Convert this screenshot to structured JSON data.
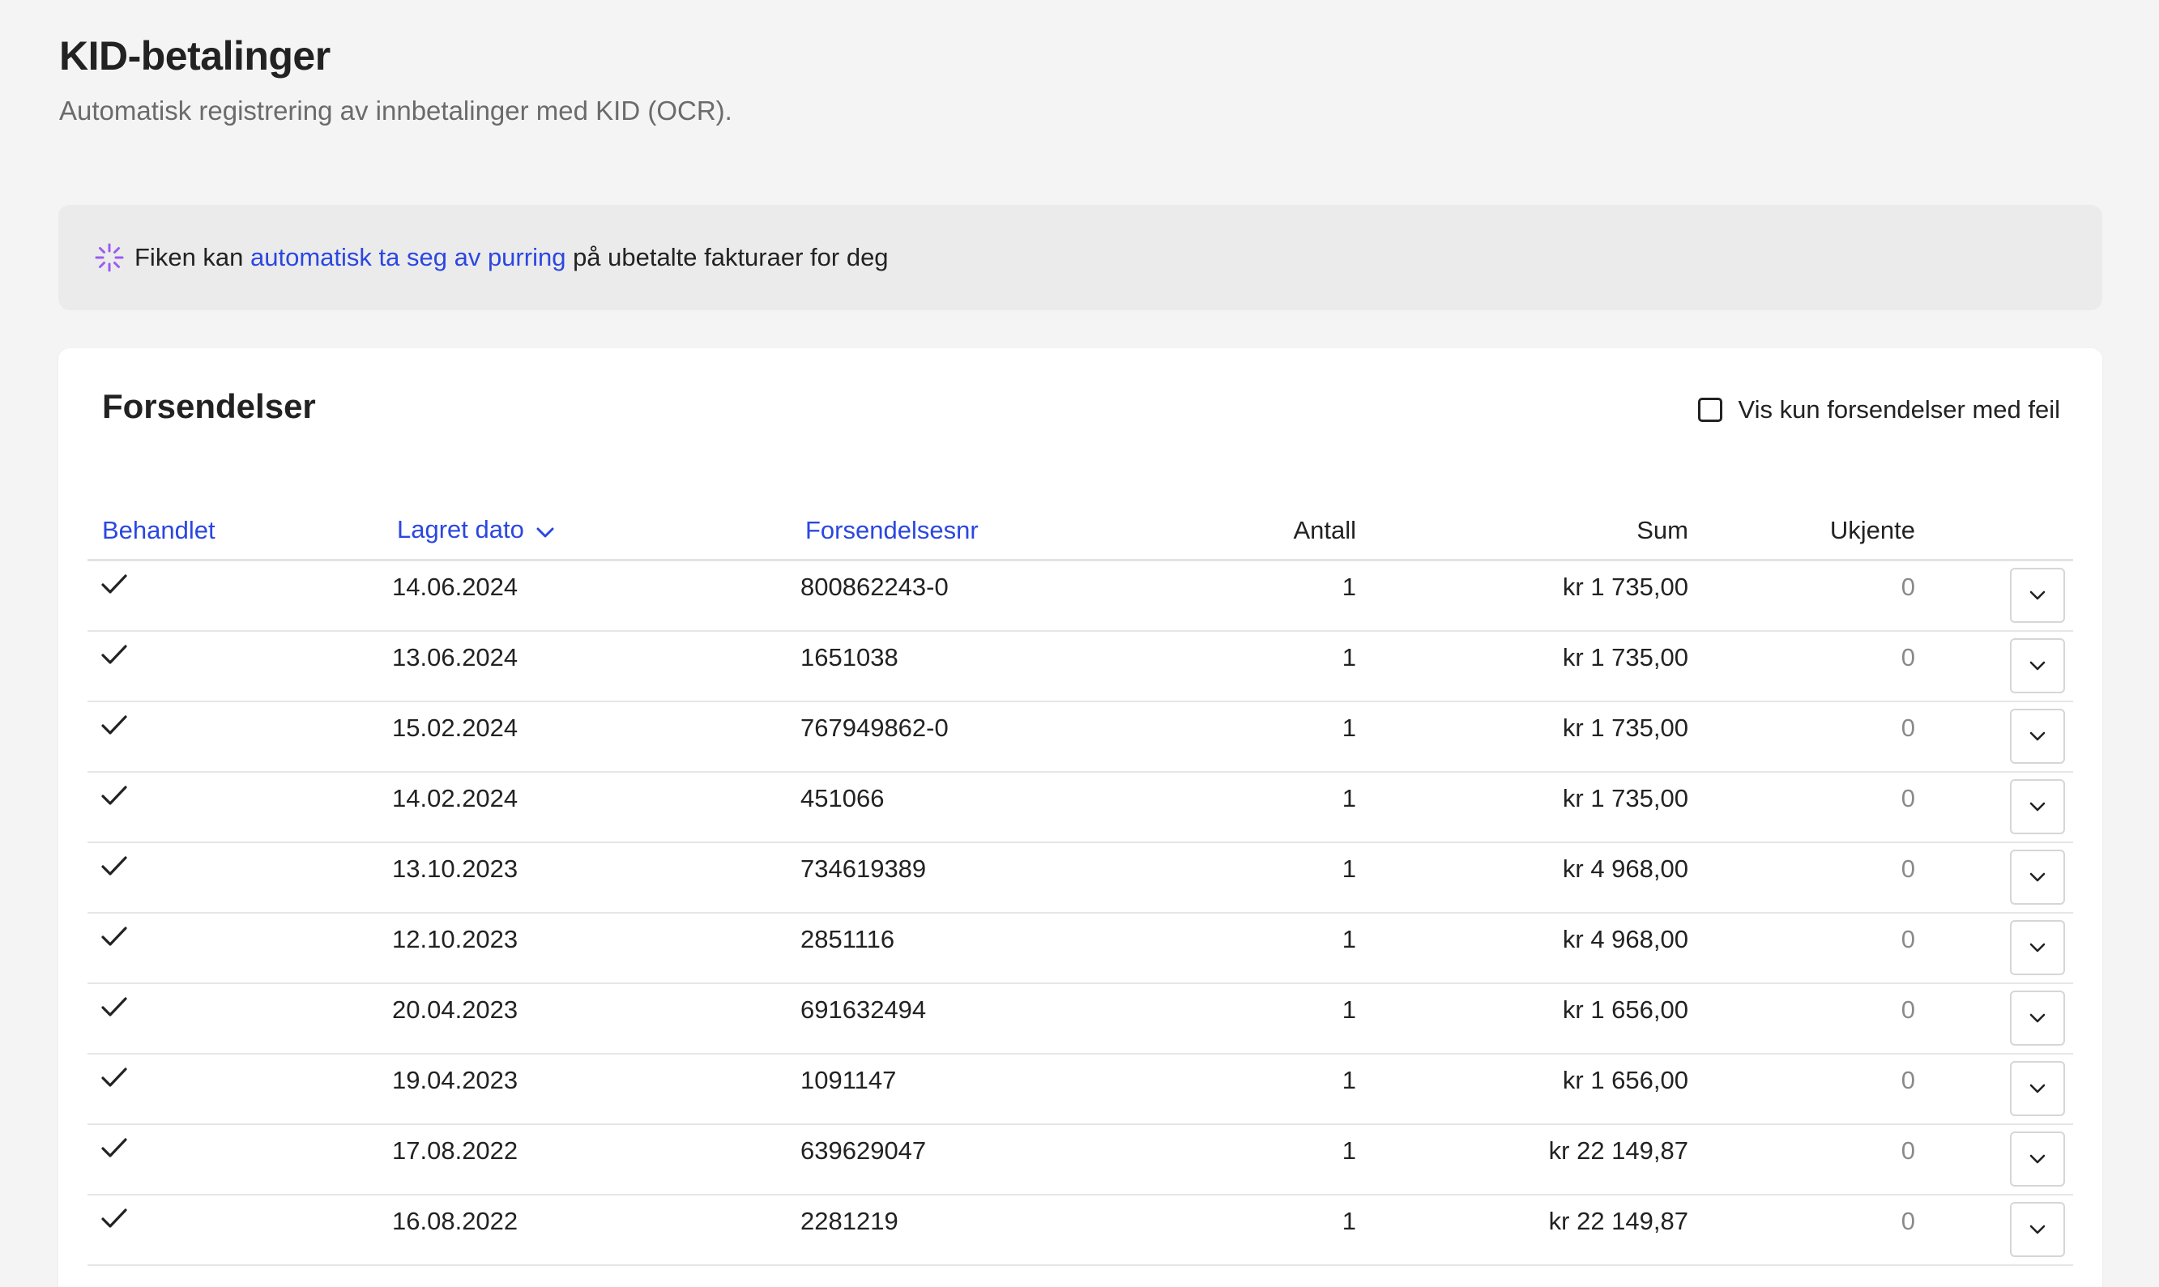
{
  "header": {
    "title": "KID-betalinger",
    "subtitle": "Automatisk registrering av innbetalinger med KID (OCR)."
  },
  "banner": {
    "icon": "sparkle-icon",
    "text_before": "Fiken kan ",
    "link_text": "automatisk ta seg av purring",
    "text_after": " på ubetalte fakturaer for deg"
  },
  "card": {
    "title": "Forsendelser",
    "filter_label": "Vis kun forsendelser med feil",
    "filter_checked": false
  },
  "table": {
    "columns": {
      "behandlet": "Behandlet",
      "lagret_dato": "Lagret dato",
      "forsendelsesnr": "Forsendelsesnr",
      "antall": "Antall",
      "sum": "Sum",
      "ukjente": "Ukjente"
    },
    "rows": [
      {
        "date": "14.06.2024",
        "nr": "800862243-0",
        "antall": "1",
        "sum": "kr 1 735,00",
        "ukjente": "0"
      },
      {
        "date": "13.06.2024",
        "nr": "1651038",
        "antall": "1",
        "sum": "kr 1 735,00",
        "ukjente": "0"
      },
      {
        "date": "15.02.2024",
        "nr": "767949862-0",
        "antall": "1",
        "sum": "kr 1 735,00",
        "ukjente": "0"
      },
      {
        "date": "14.02.2024",
        "nr": "451066",
        "antall": "1",
        "sum": "kr 1 735,00",
        "ukjente": "0"
      },
      {
        "date": "13.10.2023",
        "nr": "734619389",
        "antall": "1",
        "sum": "kr 4 968,00",
        "ukjente": "0"
      },
      {
        "date": "12.10.2023",
        "nr": "2851116",
        "antall": "1",
        "sum": "kr 4 968,00",
        "ukjente": "0"
      },
      {
        "date": "20.04.2023",
        "nr": "691632494",
        "antall": "1",
        "sum": "kr 1 656,00",
        "ukjente": "0"
      },
      {
        "date": "19.04.2023",
        "nr": "1091147",
        "antall": "1",
        "sum": "kr 1 656,00",
        "ukjente": "0"
      },
      {
        "date": "17.08.2022",
        "nr": "639629047",
        "antall": "1",
        "sum": "kr 22 149,87",
        "ukjente": "0"
      },
      {
        "date": "16.08.2022",
        "nr": "2281219",
        "antall": "1",
        "sum": "kr 22 149,87",
        "ukjente": "0"
      }
    ]
  },
  "colors": {
    "link": "#2b47e0",
    "sparkle": "#9b5cf0",
    "background": "#f4f4f4"
  }
}
